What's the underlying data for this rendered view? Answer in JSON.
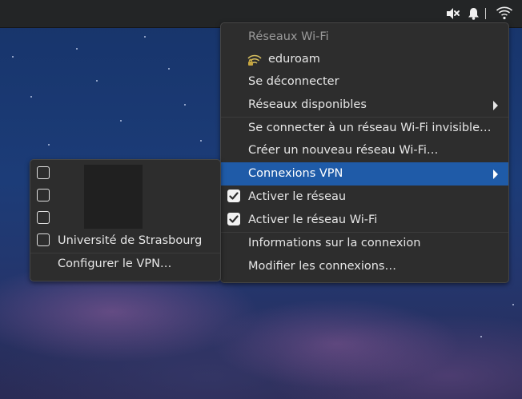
{
  "wifi_menu": {
    "header": "Réseaux Wi-Fi",
    "current_network": "eduroam",
    "disconnect": "Se déconnecter",
    "available_networks": "Réseaux disponibles",
    "connect_hidden": "Se connecter à un réseau Wi-Fi invisible…",
    "create_new": "Créer un nouveau réseau Wi-Fi…",
    "vpn_connections": "Connexions VPN",
    "enable_network": "Activer le réseau",
    "enable_wifi": "Activer le réseau Wi-Fi",
    "connection_info": "Informations sur la connexion",
    "edit_connections": "Modifier les connexions…"
  },
  "vpn_submenu": {
    "items": [
      {
        "label": "",
        "checked": false
      },
      {
        "label": "",
        "checked": false
      },
      {
        "label": "",
        "checked": false
      },
      {
        "label": "Université de Strasbourg",
        "checked": false
      }
    ],
    "configure": "Configurer le VPN…"
  },
  "tray_icons": [
    "volume-muted-icon",
    "notification-bell-icon",
    "wifi-icon"
  ],
  "colors": {
    "highlight": "#1f5ba8",
    "menu_bg": "#2d2d2d",
    "topbar_bg": "#232526"
  }
}
